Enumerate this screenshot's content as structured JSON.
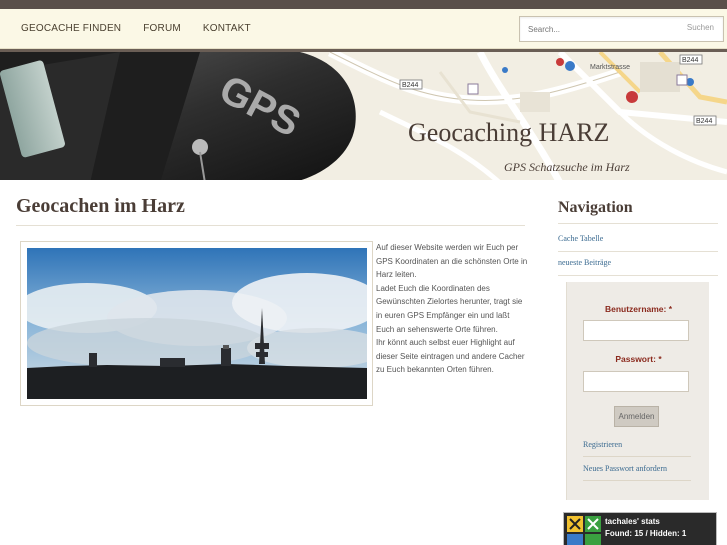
{
  "nav": {
    "items": [
      {
        "label": "GEOCACHE FINDEN"
      },
      {
        "label": "FORUM"
      },
      {
        "label": "KONTAKT"
      }
    ]
  },
  "search": {
    "placeholder": "Search...",
    "button_label": "Suchen"
  },
  "header": {
    "title": "Geocaching HARZ",
    "subtitle": "GPS Schatzsuche im Harz",
    "map_labels": {
      "road1": "B244",
      "road2": "B244",
      "road3": "B244",
      "street": "Marktstrasse"
    },
    "device_text": "GPS"
  },
  "article": {
    "title": "Geocachen im Harz",
    "text": "Auf dieser Website werden wir Euch per GPS Koordinaten an die schönsten Orte in Harz leiten.\nLadet Euch die Koordinaten des Gewünschten Zielortes herunter, tragt sie in euren GPS Empfänger ein und laßt Euch an sehenswerte Orte führen.\nIhr könnt auch selbst euer Highlight auf dieser Seite eintragen und andere Cacher zu Euch bekannten Orten führen."
  },
  "sidebar": {
    "title": "Navigation",
    "links": [
      {
        "label": "Cache Tabelle"
      },
      {
        "label": "neueste Beiträge"
      }
    ],
    "login": {
      "username_label": "Benutzername: *",
      "password_label": "Passwort: *",
      "submit_label": "Anmelden",
      "register_label": "Registrieren",
      "reset_label": "Neues Passwort anfordern"
    },
    "stats": {
      "user_line": "tachales' stats",
      "counts_line": "Found: 15 / Hidden: 1"
    }
  },
  "colors": {
    "accent_brown": "#4a3d36",
    "nav_bg": "#fbf8e6",
    "link_blue": "#3a6a90",
    "label_red": "#8b2a1e"
  }
}
